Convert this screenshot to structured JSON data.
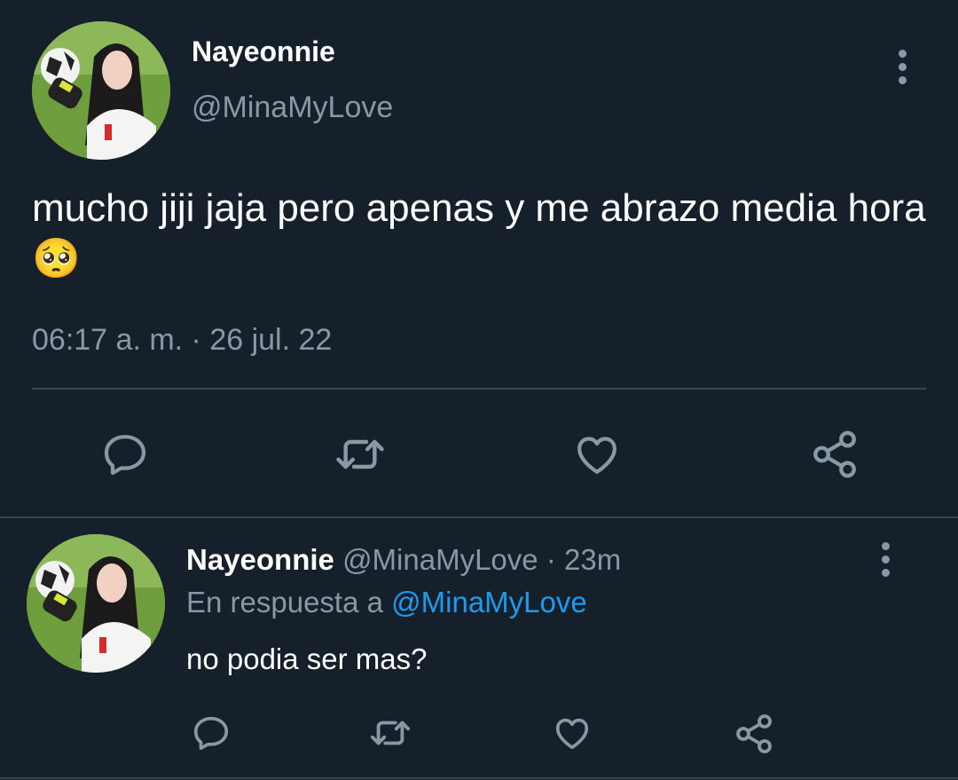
{
  "main_tweet": {
    "display_name": "Nayeonnie",
    "handle": "@MinaMyLove",
    "text": "mucho jiji jaja pero apenas y me abrazo media hora 🥺",
    "timestamp": "06:17 a. m. · 26 jul. 22",
    "actions": [
      "reply-icon",
      "retweet-icon",
      "like-icon",
      "share-icon"
    ]
  },
  "reply_tweet": {
    "display_name": "Nayeonnie",
    "handle": "@MinaMyLove",
    "separator": "·",
    "age": "23m",
    "reply_prefix": "En respuesta a",
    "reply_to": "@MinaMyLove",
    "text": "no podia ser mas?",
    "actions": [
      "reply-icon",
      "retweet-icon",
      "like-icon",
      "share-icon"
    ]
  },
  "colors": {
    "background": "#15202b",
    "text": "#ffffff",
    "muted": "#8899a6",
    "link": "#1d9bf0",
    "divider": "#38444d"
  }
}
